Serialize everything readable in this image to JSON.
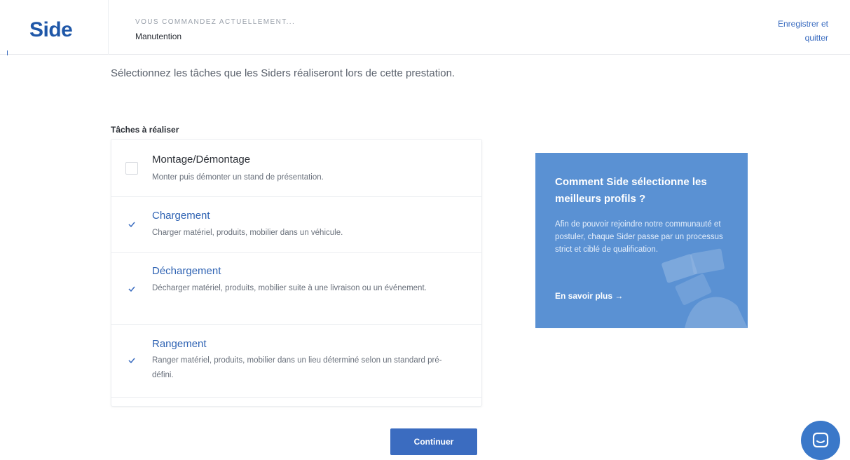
{
  "header": {
    "logo": "Side",
    "order_caption": "VOUS COMMANDEZ ACTUELLEMENT...",
    "order_value": "Manutention",
    "save_quit_line1": "Enregistrer et",
    "save_quit_line2": "quitter"
  },
  "intro": "Sélectionnez les tâches que les Siders réaliseront lors de cette prestation.",
  "tasks_label": "Tâches à réaliser",
  "tasks": [
    {
      "title": "Montage/Démontage",
      "description": "Monter puis démonter un stand de présentation.",
      "checked": false
    },
    {
      "title": "Chargement",
      "description": "Charger matériel, produits, mobilier dans un véhicule.",
      "checked": true
    },
    {
      "title": "Déchargement",
      "description": "Décharger matériel, produits, mobilier suite à une livraison ou un événement.",
      "checked": true
    },
    {
      "title": "Rangement",
      "description": "Ranger matériel, produits, mobilier dans un lieu déterminé selon un standard pré-défini.",
      "checked": true
    }
  ],
  "continue_label": "Continuer",
  "info_card": {
    "title": "Comment Side sélectionne les meilleurs profils ?",
    "text": "Afin de pouvoir rejoindre notre communauté et postuler, chaque Sider passe par un processus strict et ciblé de qualification.",
    "link": "En savoir plus →"
  },
  "colors": {
    "brand": "#1f57a8",
    "accent": "#3b6cc0",
    "card": "#5a91d3"
  },
  "icons": {
    "check": "check-icon",
    "chat": "chat-icon"
  }
}
